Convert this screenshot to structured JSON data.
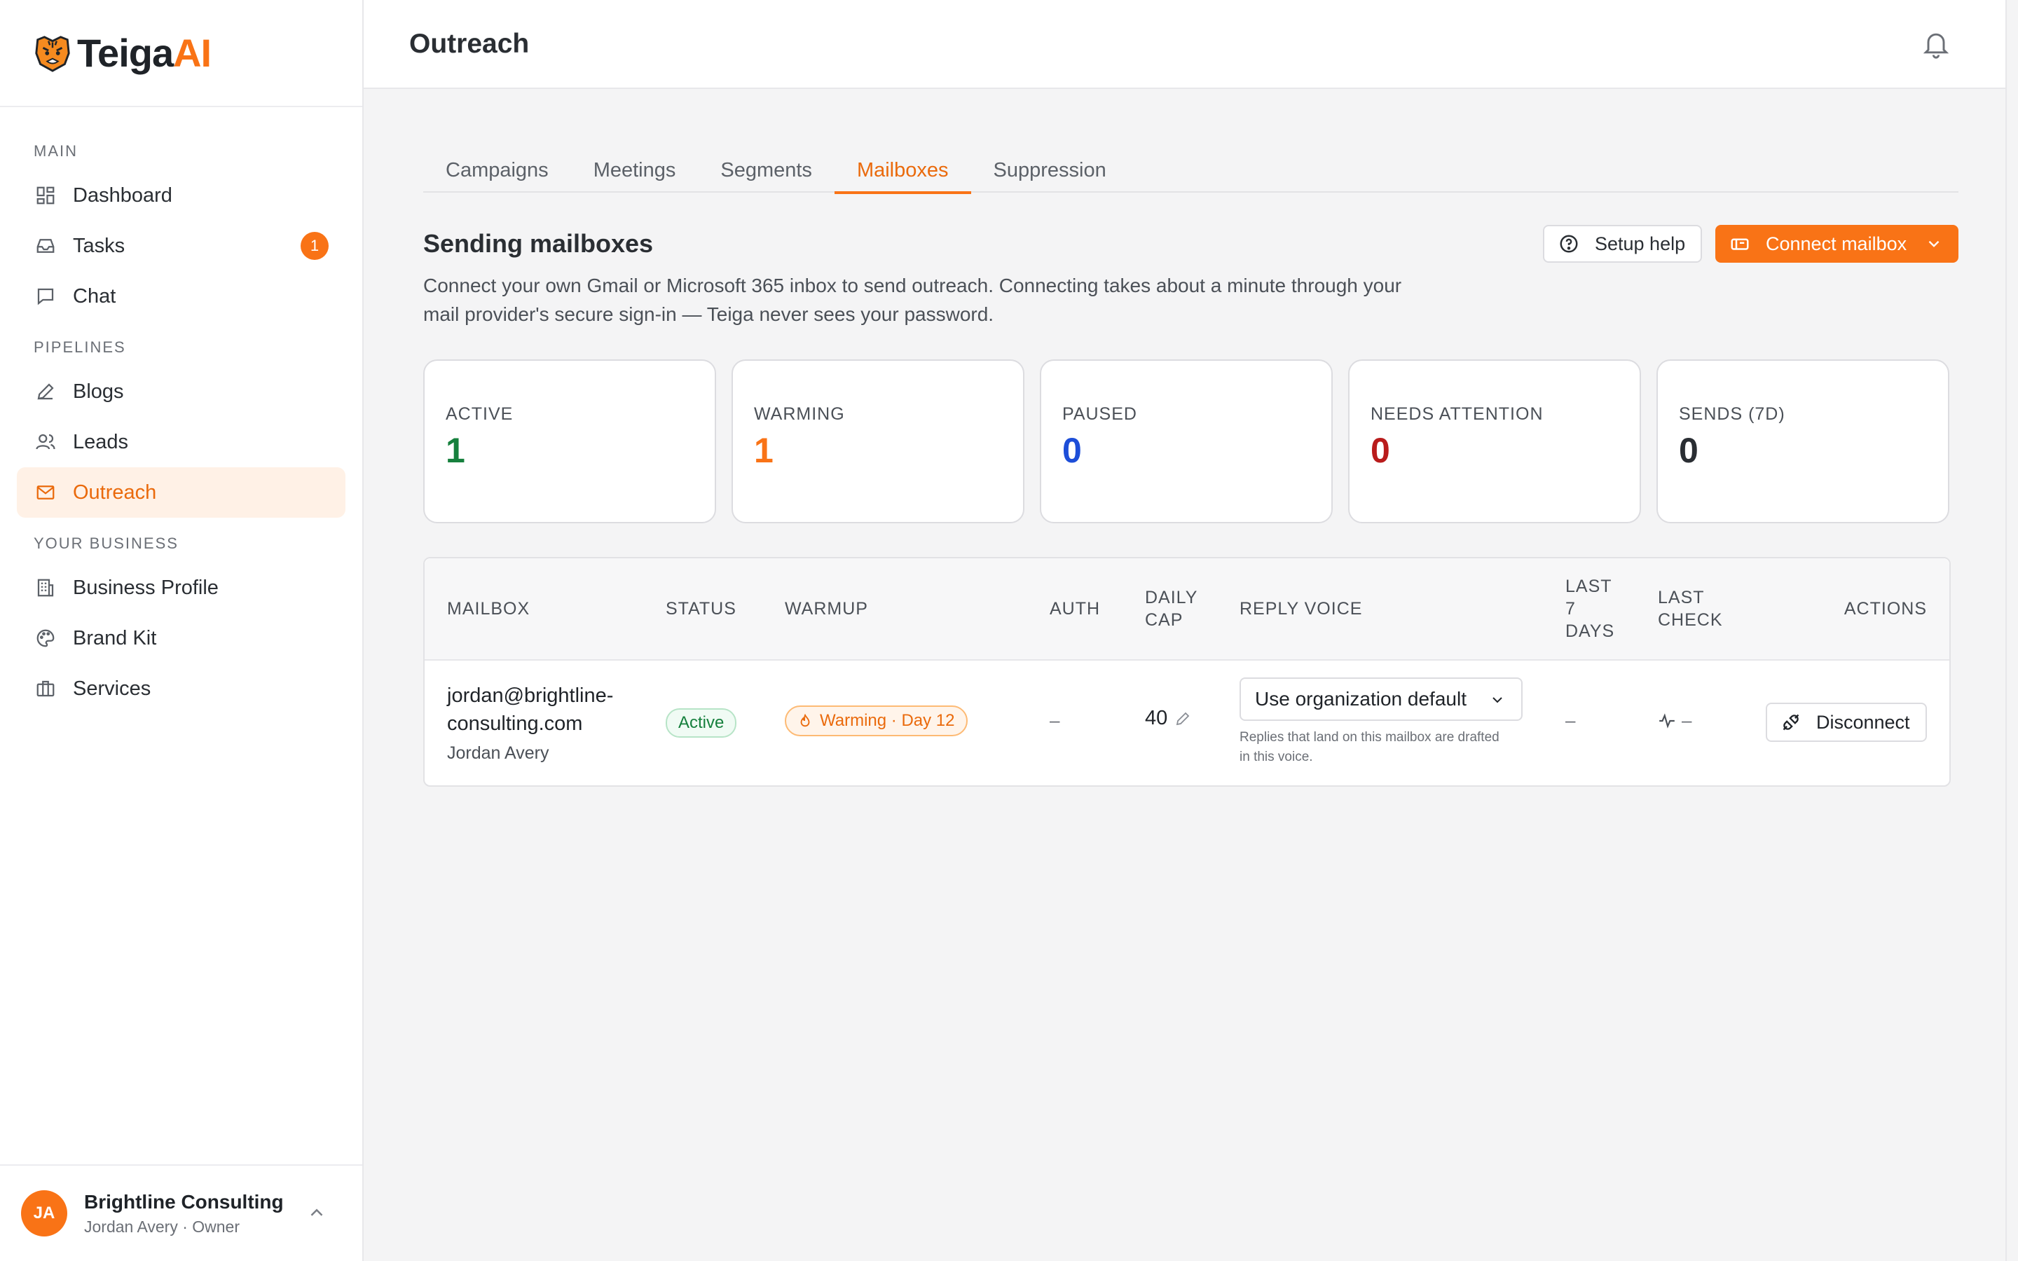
{
  "brand": {
    "name_main": "Teiga",
    "name_accent": "AI"
  },
  "sidebar": {
    "sections": [
      {
        "label": "MAIN"
      },
      {
        "label": "PIPELINES"
      },
      {
        "label": "YOUR BUSINESS"
      }
    ],
    "items": {
      "dashboard": "Dashboard",
      "tasks": "Tasks",
      "tasks_badge": "1",
      "chat": "Chat",
      "blogs": "Blogs",
      "leads": "Leads",
      "outreach": "Outreach",
      "business_profile": "Business Profile",
      "brand_kit": "Brand Kit",
      "services": "Services"
    },
    "account": {
      "initials": "JA",
      "name": "Brightline Consulting",
      "role": "Jordan Avery · Owner"
    }
  },
  "header": {
    "title": "Outreach"
  },
  "tabs": [
    "Campaigns",
    "Meetings",
    "Segments",
    "Mailboxes",
    "Suppression"
  ],
  "active_tab": "Mailboxes",
  "section": {
    "title": "Sending mailboxes",
    "description": "Connect your own Gmail or Microsoft 365 inbox to send outreach. Connecting takes about a minute through your mail provider's secure sign-in — Teiga never sees your password.",
    "setup_help": "Setup help",
    "connect_mailbox": "Connect mailbox"
  },
  "stats": [
    {
      "label": "ACTIVE",
      "value": "1",
      "color": "#16803d"
    },
    {
      "label": "WARMING",
      "value": "1",
      "color": "#f97316"
    },
    {
      "label": "PAUSED",
      "value": "0",
      "color": "#1d4ed8"
    },
    {
      "label": "NEEDS ATTENTION",
      "value": "0",
      "color": "#b91c1c"
    },
    {
      "label": "SENDS (7D)",
      "value": "0",
      "color": "#2a2e33"
    }
  ],
  "table": {
    "headers": {
      "mailbox": "MAILBOX",
      "status": "STATUS",
      "warmup": "WARMUP",
      "auth": "AUTH",
      "daily_cap_1": "DAILY",
      "daily_cap_2": "CAP",
      "reply_voice": "REPLY VOICE",
      "last7_1": "LAST",
      "last7_2": "7",
      "last7_3": "DAYS",
      "last_check_1": "LAST",
      "last_check_2": "CHECK",
      "actions": "ACTIONS"
    },
    "rows": [
      {
        "email_1": "jordan@brightline-",
        "email_2": "consulting.com",
        "owner": "Jordan Avery",
        "status": "Active",
        "warmup": "Warming · Day 12",
        "auth": "–",
        "daily_cap": "40",
        "reply_voice": "Use organization default",
        "reply_voice_help": "Replies that land on this mailbox are drafted in this voice.",
        "last7": "–",
        "last_check": "–",
        "action": "Disconnect"
      }
    ]
  }
}
